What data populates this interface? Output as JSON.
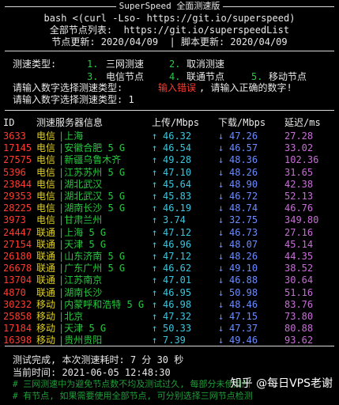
{
  "banner": {
    "title": "SuperSpeed 全面测速版",
    "command": "bash <(curl -Lso- https://git.io/superspeed)",
    "list_line": "全部节点列表:  https://git.io/superspeedList",
    "update_line": "节点更新: 2020/04/09  | 脚本更新: 2020/04/09"
  },
  "menu": {
    "label": "测速类型:",
    "options": [
      {
        "num": "1.",
        "text": "三网测速"
      },
      {
        "num": "2.",
        "text": "取消测速"
      },
      {
        "num": "3.",
        "text": "电信节点"
      },
      {
        "num": "4.",
        "text": "联通节点"
      },
      {
        "num": "5.",
        "text": "移动节点"
      }
    ],
    "prompt1": "请输入数字选择测速类型:",
    "error": "输入错误",
    "error_tail": ", 请输入正确的数字!",
    "prompt2": "请输入数字选择测速类型: 1"
  },
  "table": {
    "headers": {
      "id": "ID",
      "name": "测速服务器信息",
      "up": "上传/Mbps",
      "down": "下载/Mbps",
      "lat": "延迟/ms"
    },
    "up_arrow": "↑",
    "down_arrow": "↓",
    "rows": [
      {
        "id": "3633",
        "isp": "电信",
        "loc": "|上海",
        "up": "46.32",
        "down": "47.26",
        "lat": "27.28"
      },
      {
        "id": "17145",
        "isp": "电信",
        "loc": "|安徽合肥 5 G",
        "up": "46.54",
        "down": "46.57",
        "lat": "33.02"
      },
      {
        "id": "27575",
        "isp": "电信",
        "loc": "|新疆乌鲁木齐",
        "up": "49.28",
        "down": "48.36",
        "lat": "102.36"
      },
      {
        "id": "5396",
        "isp": "电信",
        "loc": "|江苏苏州 5 G",
        "up": "47.10",
        "down": "48.26",
        "lat": "31.65"
      },
      {
        "id": "23844",
        "isp": "电信",
        "loc": "|湖北武汉",
        "up": "45.64",
        "down": "48.90",
        "lat": "42.38"
      },
      {
        "id": "29353",
        "isp": "电信",
        "loc": "|湖北武汉 5 G",
        "up": "45.83",
        "down": "46.72",
        "lat": "52.13"
      },
      {
        "id": "28225",
        "isp": "电信",
        "loc": "|湖南长沙 5 G",
        "up": "46.19",
        "down": "48.74",
        "lat": "46.76"
      },
      {
        "id": "3973",
        "isp": "电信",
        "loc": "|甘肃兰州",
        "up": "3.74",
        "down": "32.75",
        "lat": "349.80"
      },
      {
        "id": "24447",
        "isp": "联通",
        "loc": "|上海 5 G",
        "up": "47.12",
        "down": "46.73",
        "lat": "27.16"
      },
      {
        "id": "27154",
        "isp": "联通",
        "loc": "|天津 5 G",
        "up": "46.96",
        "down": "48.07",
        "lat": "45.14"
      },
      {
        "id": "26180",
        "isp": "联通",
        "loc": "|山东济南 5 G",
        "up": "47.12",
        "down": "48.26",
        "lat": "44.35"
      },
      {
        "id": "26678",
        "isp": "联通",
        "loc": "|广东广州 5 G",
        "up": "46.62",
        "down": "49.10",
        "lat": "38.52"
      },
      {
        "id": "13704",
        "isp": "联通",
        "loc": "|江苏南京",
        "up": "47.01",
        "down": "46.88",
        "lat": "30.64"
      },
      {
        "id": "4870",
        "isp": "联通",
        "loc": "|湖南长沙",
        "up": "46.95",
        "down": "50.98",
        "lat": "51.16"
      },
      {
        "id": "30232",
        "isp": "移动",
        "loc": "|内蒙呼和浩特 5 G",
        "up": "46.98",
        "down": "48.46",
        "lat": "83.76"
      },
      {
        "id": "25858",
        "isp": "移动",
        "loc": "|北京",
        "up": "47.32",
        "down": "47.15",
        "lat": "73.80"
      },
      {
        "id": "17184",
        "isp": "移动",
        "loc": "|天津 5 G",
        "up": "50.33",
        "down": "47.37",
        "lat": "80.88"
      },
      {
        "id": "16398",
        "isp": "移动",
        "loc": "|贵州贵阳",
        "up": "7.39",
        "down": "49.46",
        "lat": "93.62"
      }
    ]
  },
  "footer": {
    "done": "测试完成, 本次测速耗时: 7 分 30 秒",
    "time": "当前时间: 2021-06-05 12:48:30",
    "note1": "# 三网测速中为避免节点数不均及测试过久, 每部分未使用所",
    "note2": "# 有节点, 如果需要使用全部节点, 可分别选择三网节点检测"
  },
  "watermark": "知乎 @每日VPS老谢",
  "colors": {
    "green": "#27c93f",
    "yellow": "#e0d020",
    "red": "#ff3b30",
    "cyan": "#3ac6dd",
    "blue": "#6a8cff",
    "magenta": "#c86dd7"
  }
}
